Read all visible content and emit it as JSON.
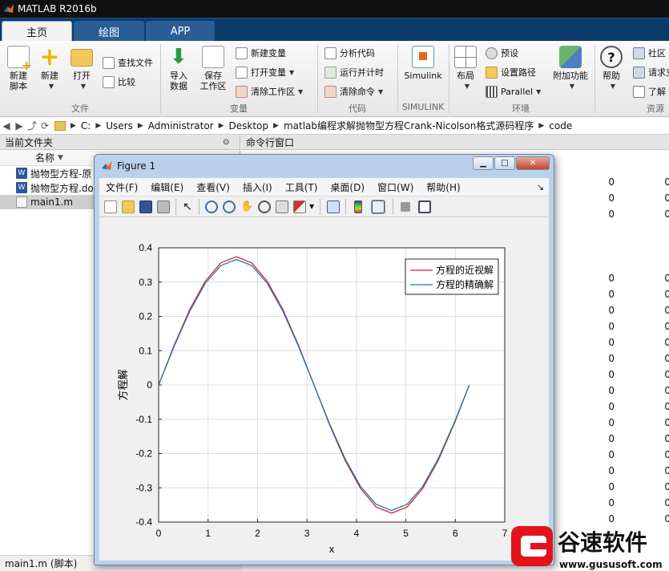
{
  "window": {
    "title": "MATLAB R2016b"
  },
  "tabs": [
    {
      "label": "主页"
    },
    {
      "label": "绘图"
    },
    {
      "label": "APP"
    }
  ],
  "ribbon": {
    "new_script": "新建\n脚本",
    "new": "新建",
    "open": "打开",
    "find_files": "查找文件",
    "compare": "比较",
    "import_data": "导入\n数据",
    "save_workspace": "保存\n工作区",
    "new_variable": "新建变量",
    "open_variable": "打开变量",
    "clear_workspace": "清除工作区",
    "analyze_code": "分析代码",
    "run_and_time": "运行并计时",
    "clear_commands": "清除命令",
    "simulink": "Simulink",
    "layout": "布局",
    "preferences": "预设",
    "set_path": "设置路径",
    "parallel": "Parallel",
    "add_ons": "附加功能",
    "help": "帮助",
    "community": "社区",
    "request_support": "请求支",
    "learn": "了解",
    "groups": {
      "file": "文件",
      "variable": "变量",
      "code": "代码",
      "simulink": "SIMULINK",
      "environment": "环境",
      "resources": "资源"
    }
  },
  "address": {
    "crumbs": [
      "C:",
      "Users",
      "Administrator",
      "Desktop",
      "matlab编程求解抛物型方程Crank-Nicolson格式源码程序",
      "code"
    ]
  },
  "left_panel": {
    "title": "当前文件夹",
    "column_name": "名称",
    "files": [
      "抛物型方程-原",
      "抛物型方程.do",
      "main1.m"
    ],
    "status": "main1.m  (脚本)"
  },
  "command_window": {
    "title": "命令行窗口",
    "zero": "0"
  },
  "figure": {
    "title": "Figure 1",
    "menus": [
      "文件(F)",
      "编辑(E)",
      "查看(V)",
      "插入(I)",
      "工具(T)",
      "桌面(D)",
      "窗口(W)",
      "帮助(H)"
    ]
  },
  "chart_data": {
    "type": "line",
    "xlabel": "x",
    "ylabel": "方程解",
    "xlim": [
      0,
      7
    ],
    "ylim": [
      -0.4,
      0.4
    ],
    "xticks": [
      0,
      1,
      2,
      3,
      4,
      5,
      6,
      7
    ],
    "yticks": [
      -0.4,
      -0.3,
      -0.2,
      -0.1,
      0,
      0.1,
      0.2,
      0.3,
      0.4
    ],
    "grid": true,
    "legend": "top-right",
    "x": [
      0,
      0.314,
      0.628,
      0.942,
      1.257,
      1.571,
      1.885,
      2.199,
      2.513,
      2.827,
      3.142,
      3.456,
      3.77,
      4.084,
      4.398,
      4.712,
      5.027,
      5.341,
      5.655,
      5.969,
      6.283
    ],
    "series": [
      {
        "name": "方程的近视解",
        "color": "#d62728",
        "values": [
          0,
          0.116,
          0.22,
          0.302,
          0.356,
          0.374,
          0.356,
          0.302,
          0.22,
          0.116,
          0,
          -0.116,
          -0.22,
          -0.302,
          -0.356,
          -0.374,
          -0.356,
          -0.302,
          -0.22,
          -0.116,
          0
        ]
      },
      {
        "name": "方程的精确解",
        "color": "#1f77b4",
        "values": [
          0,
          0.113,
          0.215,
          0.296,
          0.348,
          0.366,
          0.348,
          0.296,
          0.215,
          0.113,
          0,
          -0.113,
          -0.215,
          -0.296,
          -0.348,
          -0.366,
          -0.348,
          -0.296,
          -0.215,
          -0.113,
          0
        ]
      }
    ]
  },
  "watermark": {
    "brand": "谷速软件",
    "url": "www.gususoft.com"
  },
  "colors": {
    "tab_bar": "#0d3a6b",
    "title_bar": "#101010",
    "red_series": "#d62728",
    "blue_series": "#1f77b4"
  }
}
